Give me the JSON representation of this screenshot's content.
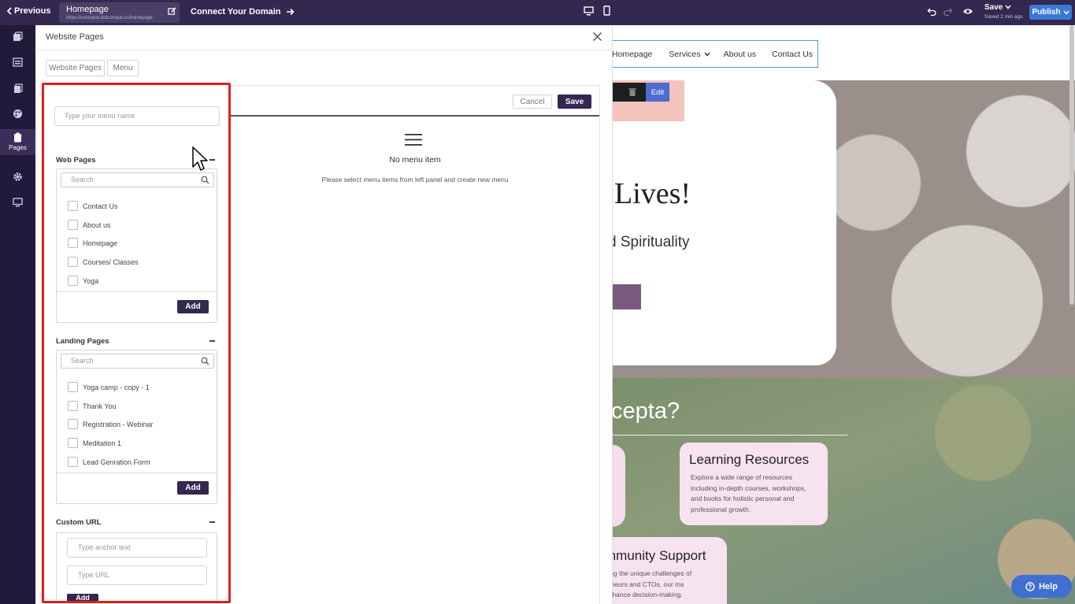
{
  "topbar": {
    "previous_label": "Previous",
    "page_title": "Homepage",
    "page_url": "https://concepta.dotcompal.co/homepage",
    "connect_label": "Connect Your Domain",
    "save_label": "Save",
    "save_meta": "Saved 2 min ago",
    "publish_label": "Publish"
  },
  "sidebar": {
    "items": [
      {
        "icon": "layers-icon",
        "label": ""
      },
      {
        "icon": "sections-icon",
        "label": ""
      },
      {
        "icon": "pages-stack-icon",
        "label": ""
      },
      {
        "icon": "palette-icon",
        "label": ""
      },
      {
        "icon": "clipboard-icon",
        "label": "Pages"
      },
      {
        "icon": "gear-icon",
        "label": ""
      },
      {
        "icon": "monitor-icon",
        "label": ""
      }
    ]
  },
  "panel": {
    "title": "Website Pages",
    "tabs": [
      "Website Pages",
      "Menu"
    ],
    "menu_name_placeholder": "Type your menu name",
    "web_pages": {
      "heading": "Web Pages",
      "search_placeholder": "Search",
      "items": [
        "Contact Us",
        "About us",
        "Homepage",
        "Courses/ Classes",
        "Yoga"
      ],
      "add_label": "Add"
    },
    "landing_pages": {
      "heading": "Landing Pages",
      "search_placeholder": "Search",
      "items": [
        "Yoga camp - copy - 1",
        "Thank You",
        "Registration - Webinar",
        "Meditation 1",
        "Lead Genration Form"
      ],
      "add_label": "Add"
    },
    "custom_url": {
      "heading": "Custom URL",
      "anchor_placeholder": "Type anchor text",
      "url_placeholder": "Type URL",
      "add_label": "Add"
    },
    "editor": {
      "cancel_label": "Cancel",
      "save_label": "Save",
      "empty_title": "No menu item",
      "empty_sub": "Please select menu items from left panel and create new menu"
    }
  },
  "preview": {
    "nav": [
      "Homepage",
      "Services",
      "About us",
      "Contact Us"
    ],
    "edit_label": "Edit",
    "hero_heading": "Lives!",
    "hero_sub": "d Spirituality",
    "section_heading": "cepta?",
    "card_learning_title": "Learning Resources",
    "card_learning_text": "Explore a wide range of resources including in-depth courses, workshops, and books for holistic personal and professional growth.",
    "card_community_title": "mmunity Support",
    "card_community_text": "sing the unique challenges of reneurs and CTOs, our ms enhance decision-making.",
    "help_label": "Help"
  },
  "colors": {
    "topbar": "#33284f",
    "sidebar": "#221a3a",
    "primary_button": "#33284f",
    "publish": "#3a79d9",
    "highlight_frame": "#e01e1e"
  }
}
